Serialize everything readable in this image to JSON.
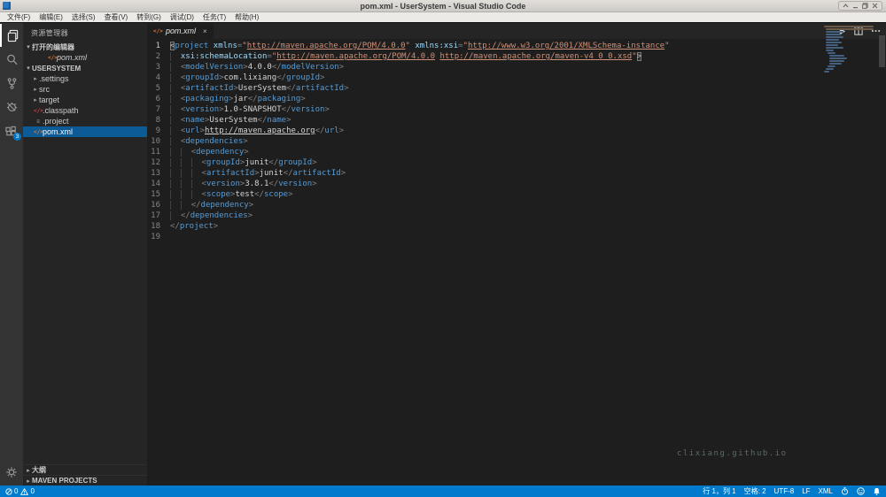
{
  "window": {
    "title": "pom.xml - UserSystem - Visual Studio Code",
    "controls": {
      "rollup": "roll-up",
      "minimize": "minimize",
      "maximize": "maximize",
      "close": "close"
    }
  },
  "menu": {
    "items": [
      "文件(F)",
      "编辑(E)",
      "选择(S)",
      "查看(V)",
      "转到(G)",
      "调试(D)",
      "任务(T)",
      "帮助(H)"
    ]
  },
  "activity_bar": {
    "badge": "3",
    "items": [
      "explorer",
      "search",
      "source-control",
      "debug",
      "extensions"
    ],
    "bottom": "settings-gear"
  },
  "sidebar": {
    "header": "资源管理器",
    "open_editors_label": "打开的编辑器",
    "open_editors": [
      {
        "label": "pom.xml",
        "icon": "xml"
      }
    ],
    "root": "USERSYSTEM",
    "tree": [
      {
        "label": ".settings",
        "kind": "folder"
      },
      {
        "label": "src",
        "kind": "folder"
      },
      {
        "label": "target",
        "kind": "folder"
      },
      {
        "label": ".classpath",
        "kind": "file",
        "icon": "classpath"
      },
      {
        "label": ".project",
        "kind": "file",
        "icon": "project"
      },
      {
        "label": "pom.xml",
        "kind": "file",
        "icon": "xml",
        "selected": true
      }
    ],
    "bottom_sections": [
      "大纲",
      "MAVEN PROJECTS"
    ]
  },
  "editor": {
    "tab": {
      "label": "pom.xml",
      "close": "×"
    },
    "actions": [
      "run",
      "split-editor",
      "more-actions"
    ],
    "watermark": "clixiang.github.io",
    "code": {
      "lines": [
        {
          "n": 1,
          "g": 0,
          "cur": true,
          "t": [
            [
              "ph",
              "<"
            ],
            [
              "t",
              "project"
            ],
            [
              "x",
              " "
            ],
            [
              "a",
              "xmlns"
            ],
            [
              "p",
              "="
            ],
            [
              "s",
              "\""
            ],
            [
              "sl",
              "http://maven.apache.org/POM/4.0.0"
            ],
            [
              "s",
              "\""
            ],
            [
              "x",
              " "
            ],
            [
              "a",
              "xmlns:xsi"
            ],
            [
              "p",
              "="
            ],
            [
              "s",
              "\""
            ],
            [
              "sl",
              "http://www.w3.org/2001/XMLSchema-instance"
            ],
            [
              "s",
              "\""
            ]
          ]
        },
        {
          "n": 2,
          "g": 1,
          "t": [
            [
              "a",
              "xsi:schemaLocation"
            ],
            [
              "p",
              "="
            ],
            [
              "s",
              "\""
            ],
            [
              "sl",
              "http://maven.apache.org/POM/4.0.0"
            ],
            [
              "s",
              " "
            ],
            [
              "sl",
              "http://maven.apache.org/maven-v4_0_0.xsd"
            ],
            [
              "s",
              "\""
            ],
            [
              "ph",
              ">"
            ]
          ]
        },
        {
          "n": 3,
          "g": 1,
          "t": [
            [
              "p",
              "<"
            ],
            [
              "t",
              "modelVersion"
            ],
            [
              "p",
              ">"
            ],
            [
              "x",
              "4.0.0"
            ],
            [
              "p",
              "</"
            ],
            [
              "t",
              "modelVersion"
            ],
            [
              "p",
              ">"
            ]
          ]
        },
        {
          "n": 4,
          "g": 1,
          "t": [
            [
              "p",
              "<"
            ],
            [
              "t",
              "groupId"
            ],
            [
              "p",
              ">"
            ],
            [
              "x",
              "com.lixiang"
            ],
            [
              "p",
              "</"
            ],
            [
              "t",
              "groupId"
            ],
            [
              "p",
              ">"
            ]
          ]
        },
        {
          "n": 5,
          "g": 1,
          "t": [
            [
              "p",
              "<"
            ],
            [
              "t",
              "artifactId"
            ],
            [
              "p",
              ">"
            ],
            [
              "x",
              "UserSystem"
            ],
            [
              "p",
              "</"
            ],
            [
              "t",
              "artifactId"
            ],
            [
              "p",
              ">"
            ]
          ]
        },
        {
          "n": 6,
          "g": 1,
          "t": [
            [
              "p",
              "<"
            ],
            [
              "t",
              "packaging"
            ],
            [
              "p",
              ">"
            ],
            [
              "x",
              "jar"
            ],
            [
              "p",
              "</"
            ],
            [
              "t",
              "packaging"
            ],
            [
              "p",
              ">"
            ]
          ]
        },
        {
          "n": 7,
          "g": 1,
          "t": [
            [
              "p",
              "<"
            ],
            [
              "t",
              "version"
            ],
            [
              "p",
              ">"
            ],
            [
              "x",
              "1.0-SNAPSHOT"
            ],
            [
              "p",
              "</"
            ],
            [
              "t",
              "version"
            ],
            [
              "p",
              ">"
            ]
          ]
        },
        {
          "n": 8,
          "g": 1,
          "t": [
            [
              "p",
              "<"
            ],
            [
              "t",
              "name"
            ],
            [
              "p",
              ">"
            ],
            [
              "x",
              "UserSystem"
            ],
            [
              "p",
              "</"
            ],
            [
              "t",
              "name"
            ],
            [
              "p",
              ">"
            ]
          ]
        },
        {
          "n": 9,
          "g": 1,
          "t": [
            [
              "p",
              "<"
            ],
            [
              "t",
              "url"
            ],
            [
              "p",
              ">"
            ],
            [
              "xl",
              "http://maven.apache.org"
            ],
            [
              "p",
              "</"
            ],
            [
              "t",
              "url"
            ],
            [
              "p",
              ">"
            ]
          ]
        },
        {
          "n": 10,
          "g": 1,
          "t": [
            [
              "p",
              "<"
            ],
            [
              "t",
              "dependencies"
            ],
            [
              "p",
              ">"
            ]
          ]
        },
        {
          "n": 11,
          "g": 2,
          "t": [
            [
              "p",
              "<"
            ],
            [
              "t",
              "dependency"
            ],
            [
              "p",
              ">"
            ]
          ]
        },
        {
          "n": 12,
          "g": 3,
          "t": [
            [
              "p",
              "<"
            ],
            [
              "t",
              "groupId"
            ],
            [
              "p",
              ">"
            ],
            [
              "x",
              "junit"
            ],
            [
              "p",
              "</"
            ],
            [
              "t",
              "groupId"
            ],
            [
              "p",
              ">"
            ]
          ]
        },
        {
          "n": 13,
          "g": 3,
          "t": [
            [
              "p",
              "<"
            ],
            [
              "t",
              "artifactId"
            ],
            [
              "p",
              ">"
            ],
            [
              "x",
              "junit"
            ],
            [
              "p",
              "</"
            ],
            [
              "t",
              "artifactId"
            ],
            [
              "p",
              ">"
            ]
          ]
        },
        {
          "n": 14,
          "g": 3,
          "t": [
            [
              "p",
              "<"
            ],
            [
              "t",
              "version"
            ],
            [
              "p",
              ">"
            ],
            [
              "x",
              "3.8.1"
            ],
            [
              "p",
              "</"
            ],
            [
              "t",
              "version"
            ],
            [
              "p",
              ">"
            ]
          ]
        },
        {
          "n": 15,
          "g": 3,
          "t": [
            [
              "p",
              "<"
            ],
            [
              "t",
              "scope"
            ],
            [
              "p",
              ">"
            ],
            [
              "x",
              "test"
            ],
            [
              "p",
              "</"
            ],
            [
              "t",
              "scope"
            ],
            [
              "p",
              ">"
            ]
          ]
        },
        {
          "n": 16,
          "g": 2,
          "t": [
            [
              "p",
              "</"
            ],
            [
              "t",
              "dependency"
            ],
            [
              "p",
              ">"
            ]
          ]
        },
        {
          "n": 17,
          "g": 1,
          "t": [
            [
              "p",
              "</"
            ],
            [
              "t",
              "dependencies"
            ],
            [
              "p",
              ">"
            ]
          ]
        },
        {
          "n": 18,
          "g": 0,
          "t": [
            [
              "p",
              "</"
            ],
            [
              "t",
              "project"
            ],
            [
              "p",
              ">"
            ]
          ]
        },
        {
          "n": 19,
          "g": 0,
          "t": []
        }
      ]
    }
  },
  "status_bar": {
    "errors": "0",
    "warnings": "0",
    "items": [
      "行 1，列 1",
      "空格: 2",
      "UTF-8",
      "LF",
      "XML"
    ],
    "icons": [
      "stopwatch",
      "feedback-smiley",
      "notifications-bell"
    ]
  }
}
